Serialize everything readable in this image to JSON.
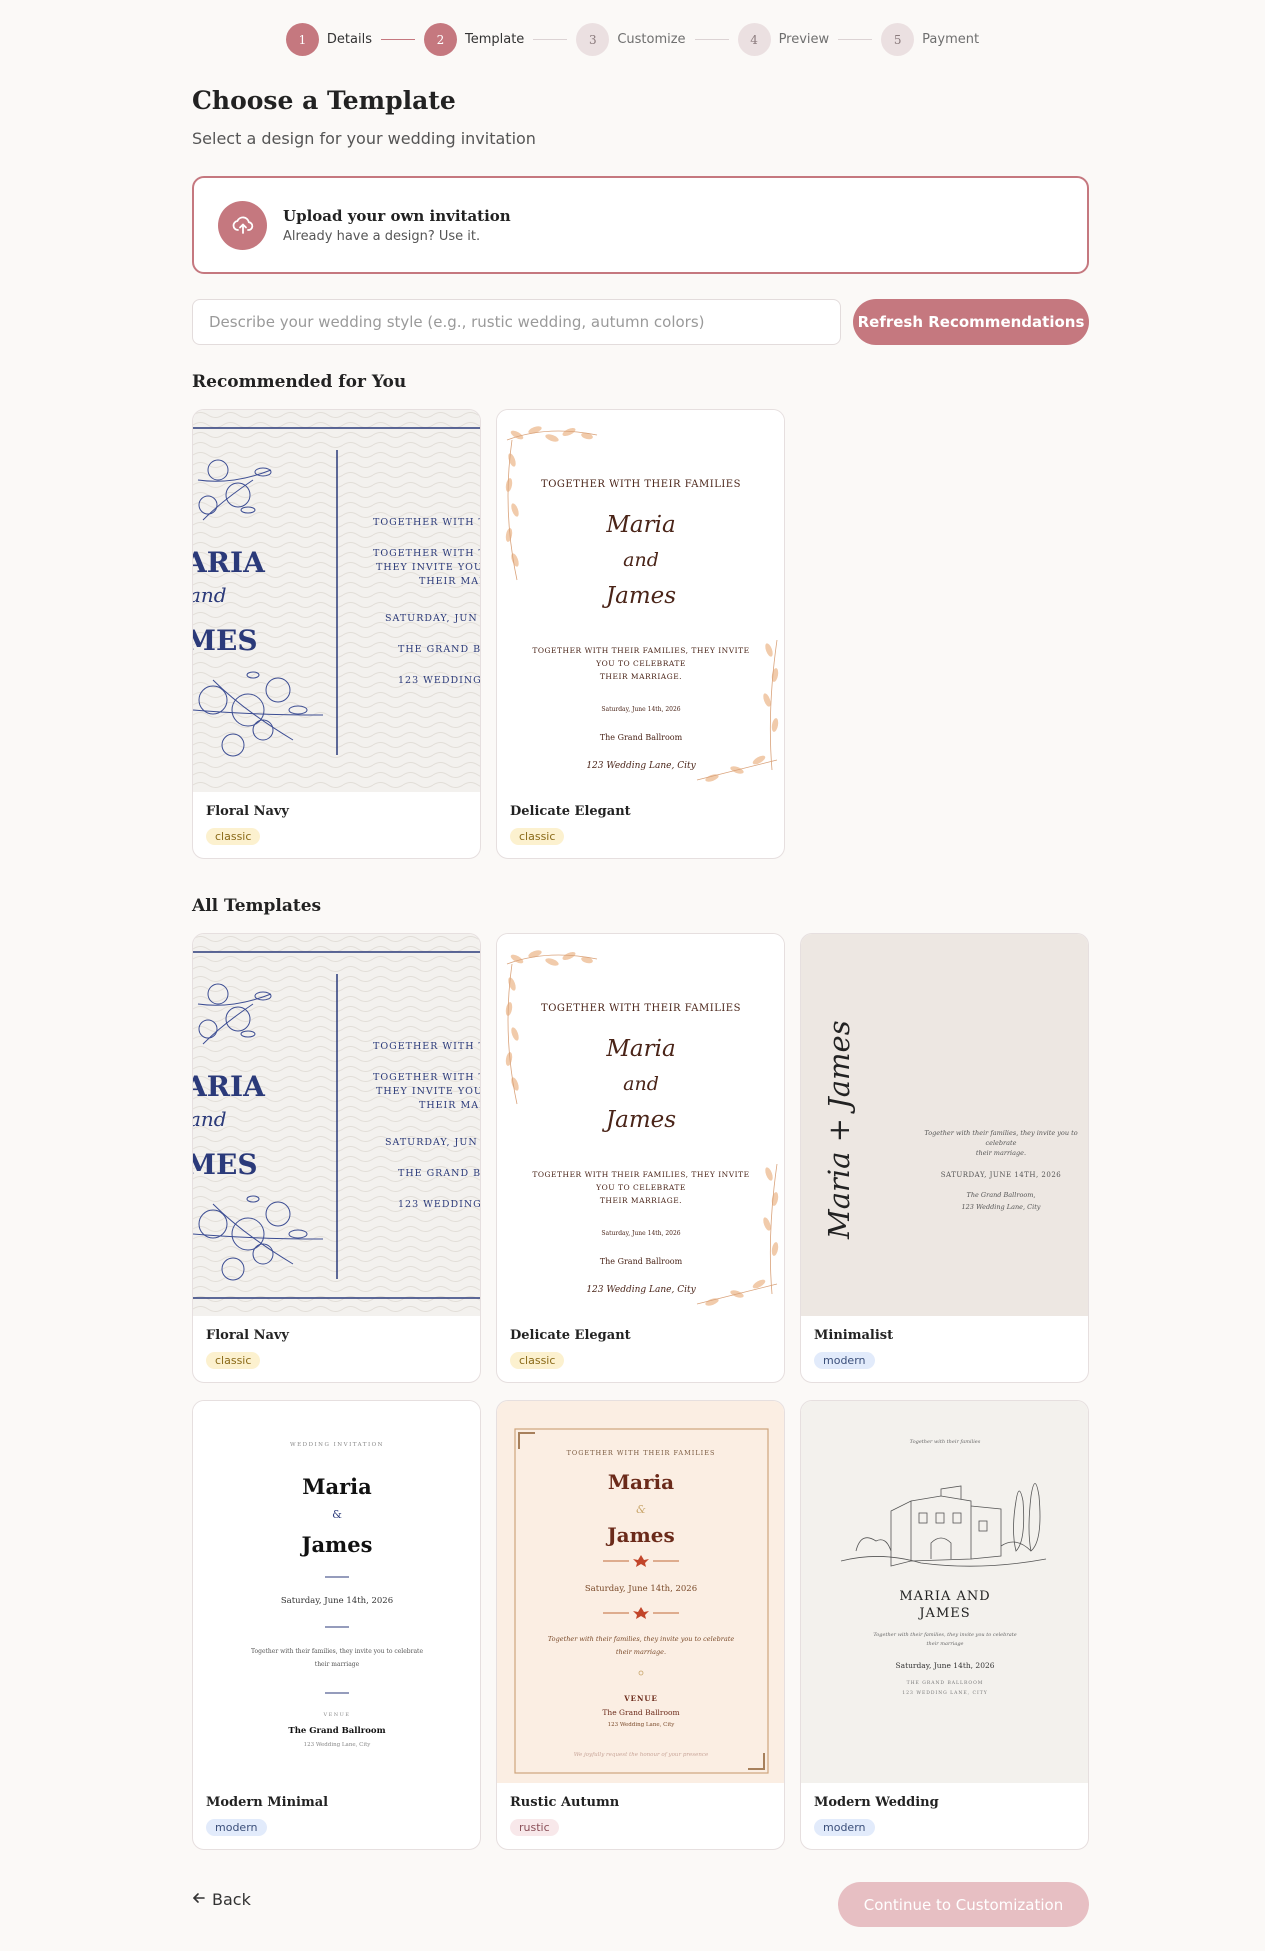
{
  "stepper": [
    {
      "num": "1",
      "label": "Details",
      "state": "active"
    },
    {
      "num": "2",
      "label": "Template",
      "state": "active"
    },
    {
      "num": "3",
      "label": "Customize",
      "state": "todo"
    },
    {
      "num": "4",
      "label": "Preview",
      "state": "todo"
    },
    {
      "num": "5",
      "label": "Payment",
      "state": "todo"
    }
  ],
  "page": {
    "title": "Choose a Template",
    "subtitle": "Select a design for your wedding invitation"
  },
  "upload": {
    "title": "Upload your own invitation",
    "subtitle": "Already have a design? Use it.",
    "icon": "cloud-upload-icon"
  },
  "search": {
    "placeholder": "Describe your wedding style (e.g., rustic wedding, autumn colors)",
    "value": ""
  },
  "refresh_label": "Refresh Recommendations",
  "sections": {
    "recommended": "Recommended for You",
    "all": "All Templates"
  },
  "templates": {
    "floral_navy": {
      "name": "Floral Navy",
      "tag": "classic"
    },
    "delicate_elegant": {
      "name": "Delicate Elegant",
      "tag": "classic"
    },
    "minimalist": {
      "name": "Minimalist",
      "tag": "modern"
    },
    "modern_minimal": {
      "name": "Modern Minimal",
      "tag": "modern"
    },
    "rustic_autumn": {
      "name": "Rustic Autumn",
      "tag": "rustic"
    },
    "modern_wedding": {
      "name": "Modern Wedding",
      "tag": "modern"
    }
  },
  "preview_text": {
    "floral_navy": {
      "names": [
        "ARIA",
        "and",
        "MES"
      ],
      "lines": [
        "TOGETHER WITH T",
        "TOGETHER WITH T",
        "THEY INVITE YOU",
        "THEIR MAR",
        "SATURDAY, JUN",
        "THE GRAND B",
        "123 WEDDING"
      ]
    },
    "delicate_elegant": {
      "top": "TOGETHER WITH THEIR FAMILIES",
      "names": [
        "Maria",
        "and",
        "James"
      ],
      "invite": [
        "TOGETHER WITH THEIR FAMILIES, THEY INVITE",
        "YOU TO CELEBRATE",
        "THEIR MARRIAGE."
      ],
      "date": "Saturday, June 14th, 2026",
      "venue": "The Grand Ballroom",
      "address": "123 Wedding Lane, City"
    },
    "minimalist": {
      "names": "Maria + James",
      "invite": [
        "Together with their families, they invite you to",
        "celebrate",
        "their marriage."
      ],
      "date": "SATURDAY, JUNE 14TH, 2026",
      "venue": "The Grand Ballroom,",
      "address": "123 Wedding Lane, City"
    },
    "modern_minimal": {
      "top": "WEDDING INVITATION",
      "names": [
        "Maria",
        "&",
        "James"
      ],
      "date": "Saturday, June 14th, 2026",
      "invite": [
        "Together with their families, they invite you to celebrate",
        "their marriage"
      ],
      "venue_label": "VENUE",
      "venue": "The Grand Ballroom",
      "address": "123 Wedding Lane, City"
    },
    "rustic_autumn": {
      "top": "TOGETHER WITH THEIR FAMILIES",
      "names": [
        "Maria",
        "&",
        "James"
      ],
      "date": "Saturday, June 14th, 2026",
      "invite": [
        "Together with their families, they invite you to celebrate",
        "their marriage."
      ],
      "venue_label": "VENUE",
      "venue": "The Grand Ballroom",
      "address": "123 Wedding Lane, City",
      "footer": "We joyfully request the honour of your presence"
    },
    "modern_wedding": {
      "top": "Together with their families",
      "names": [
        "MARIA AND",
        "JAMES"
      ],
      "invite": [
        "Together with their families, they invite you to celebrate",
        "their marriage"
      ],
      "date": "Saturday, June 14th, 2026",
      "venue": "THE GRAND BALLROOM",
      "address": "123 WEDDING LANE, CITY"
    }
  },
  "footer": {
    "back_label": "Back",
    "continue_label": "Continue to Customization"
  },
  "colors": {
    "accent": "#c5787f",
    "navy": "#2b3a7a",
    "peach": "#e9b88f",
    "brown": "#4a2418"
  }
}
